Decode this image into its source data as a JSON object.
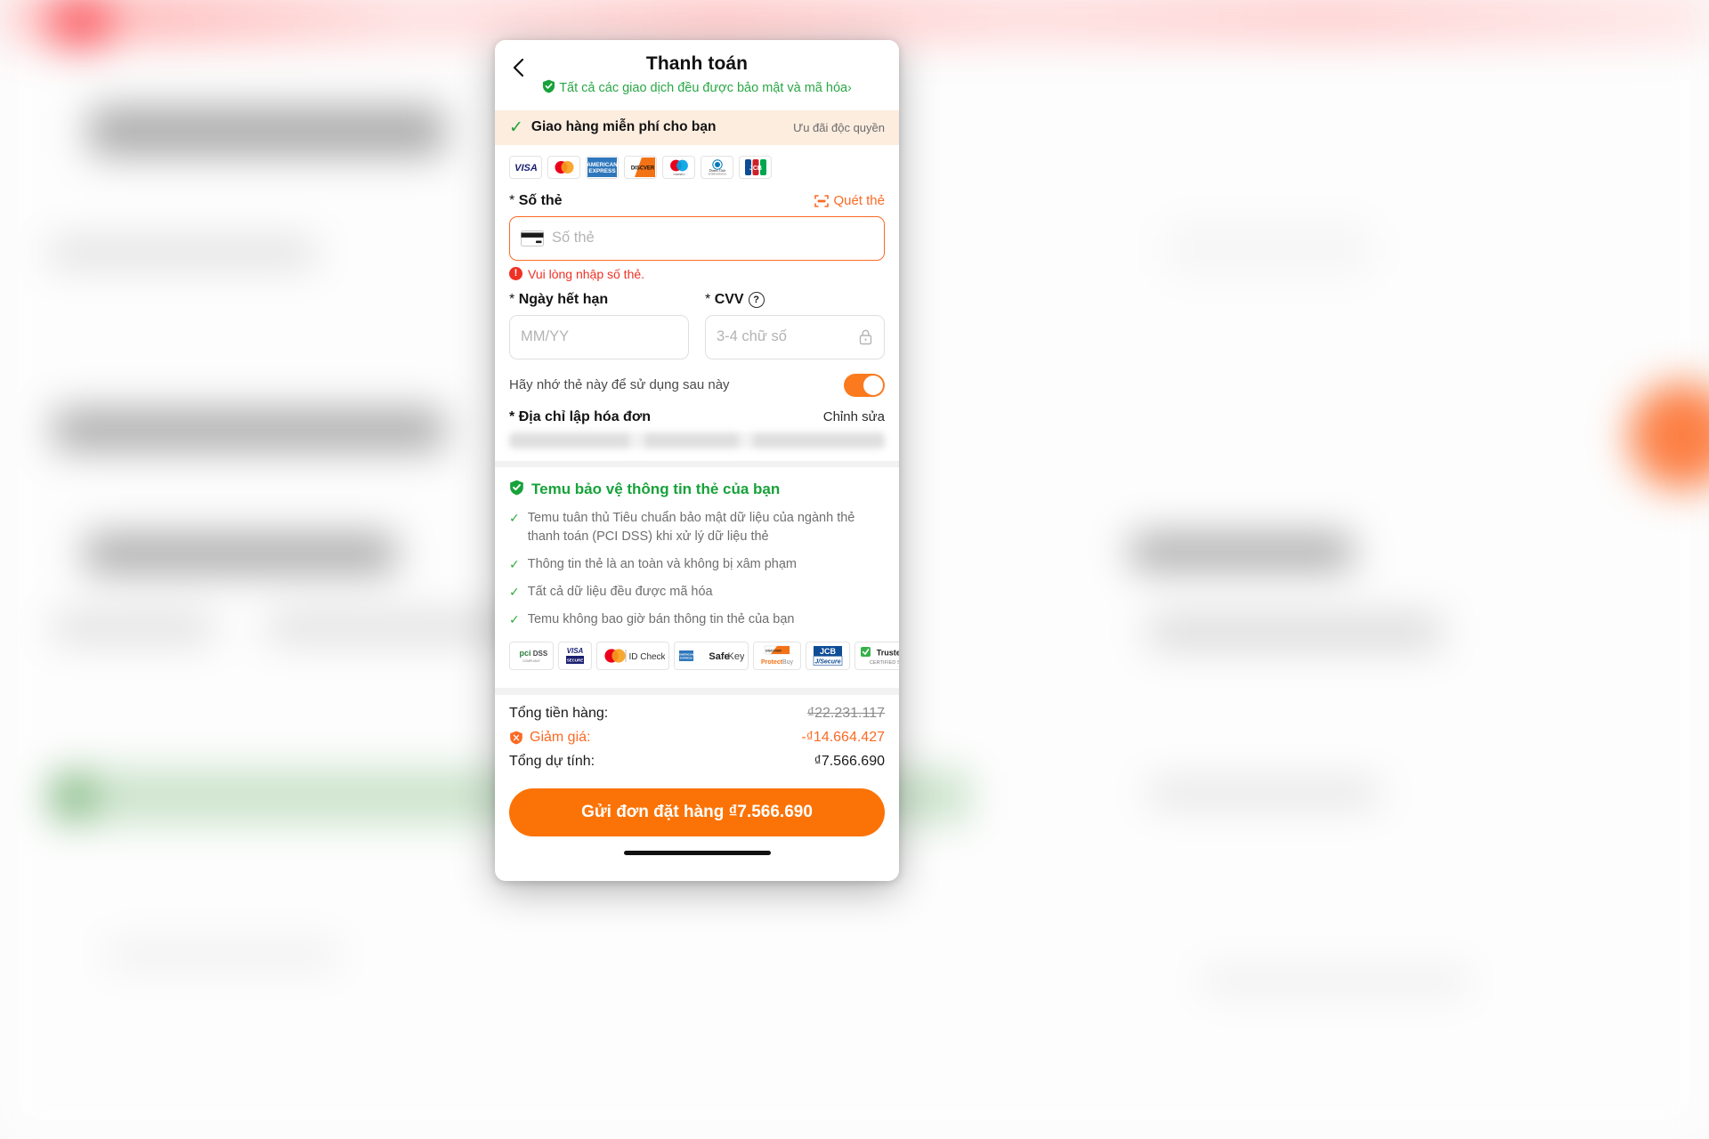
{
  "header": {
    "back_icon": "chevron-left-icon",
    "title": "Thanh toán",
    "secure_note": "Tất cả các giao dịch đều được bảo mật và mã hóa",
    "secure_note_chevron": "›",
    "shield_icon": "shield-check-icon"
  },
  "shipping_banner": {
    "check_icon": "check-icon",
    "text": "Giao hàng miễn phí cho bạn",
    "badge": "Ưu đãi độc quyền"
  },
  "card_brands": [
    {
      "name": "visa-logo",
      "label": "VISA"
    },
    {
      "name": "mastercard-logo",
      "label": "Mastercard"
    },
    {
      "name": "amex-logo",
      "label": "AMERICAN EXPRESS"
    },
    {
      "name": "discover-logo",
      "label": "DISCOVER"
    },
    {
      "name": "maestro-logo",
      "label": "maestro"
    },
    {
      "name": "diners-club-logo",
      "label": "Diners Club INTERNATIONAL"
    },
    {
      "name": "jcb-logo",
      "label": "JCB"
    }
  ],
  "card_number": {
    "required_mark": "*",
    "label": "Số thẻ",
    "scan_label": "Quét thẻ",
    "scan_icon": "scan-frame-icon",
    "card_icon": "credit-card-icon",
    "placeholder": "Số thẻ",
    "value": "",
    "error": "Vui lòng nhập số thẻ.",
    "error_icon": "error-exclamation-icon"
  },
  "expiry": {
    "required_mark": "*",
    "label": "Ngày hết hạn",
    "placeholder": "MM/YY",
    "value": ""
  },
  "cvv": {
    "required_mark": "*",
    "label": "CVV",
    "help_icon": "question-mark-icon",
    "placeholder": "3-4 chữ số",
    "value": "",
    "lock_icon": "lock-icon"
  },
  "remember": {
    "label": "Hãy nhớ thẻ này để sử dụng sau này",
    "enabled": true
  },
  "billing_address": {
    "required_mark": "*",
    "label": "Địa chỉ lập hóa đơn",
    "edit_label": "Chỉnh sửa",
    "value": ""
  },
  "security": {
    "shield_icon": "shield-check-icon",
    "title": "Temu bảo vệ thông tin thẻ của bạn",
    "items": [
      "Temu tuân thủ Tiêu chuẩn bảo mật dữ liệu của ngành thẻ thanh toán (PCI DSS) khi xử lý dữ liệu thẻ",
      "Thông tin thẻ là an toàn và không bị xâm phạm",
      "Tất cả dữ liệu đều được mã hóa",
      "Temu không bao giờ bán thông tin thẻ của bạn"
    ],
    "check_icon": "check-icon",
    "badges": [
      {
        "name": "pci-dss-badge",
        "label": "PCI DSS"
      },
      {
        "name": "visa-secure-badge",
        "label": "VISA SECURE"
      },
      {
        "name": "mastercard-id-check-badge",
        "label": "ID Check"
      },
      {
        "name": "amex-safekey-badge",
        "label": "SafeKey"
      },
      {
        "name": "discover-protectbuy-badge",
        "label": "ProtectBuy"
      },
      {
        "name": "jcb-jsecure-badge",
        "label": "JCB J/Secure"
      },
      {
        "name": "trustedsite-badge",
        "label": "TrustedSite CERTIFIED SECURE"
      }
    ]
  },
  "totals": {
    "subtotal_label": "Tổng tiền hàng:",
    "subtotal_value": "₫22.231.117",
    "discount_label": "Giảm giá:",
    "discount_value": "-₫14.664.427",
    "discount_icon": "discount-tag-icon",
    "total_label": "Tổng dự tính:",
    "total_value": "₫7.566.690"
  },
  "submit": {
    "label": "Gửi đơn đặt hàng ₫7.566.690"
  },
  "colors": {
    "accent_orange": "#fb7306",
    "green": "#17a23a",
    "error_red": "#ef3124",
    "banner_bg": "#fdeddf"
  }
}
